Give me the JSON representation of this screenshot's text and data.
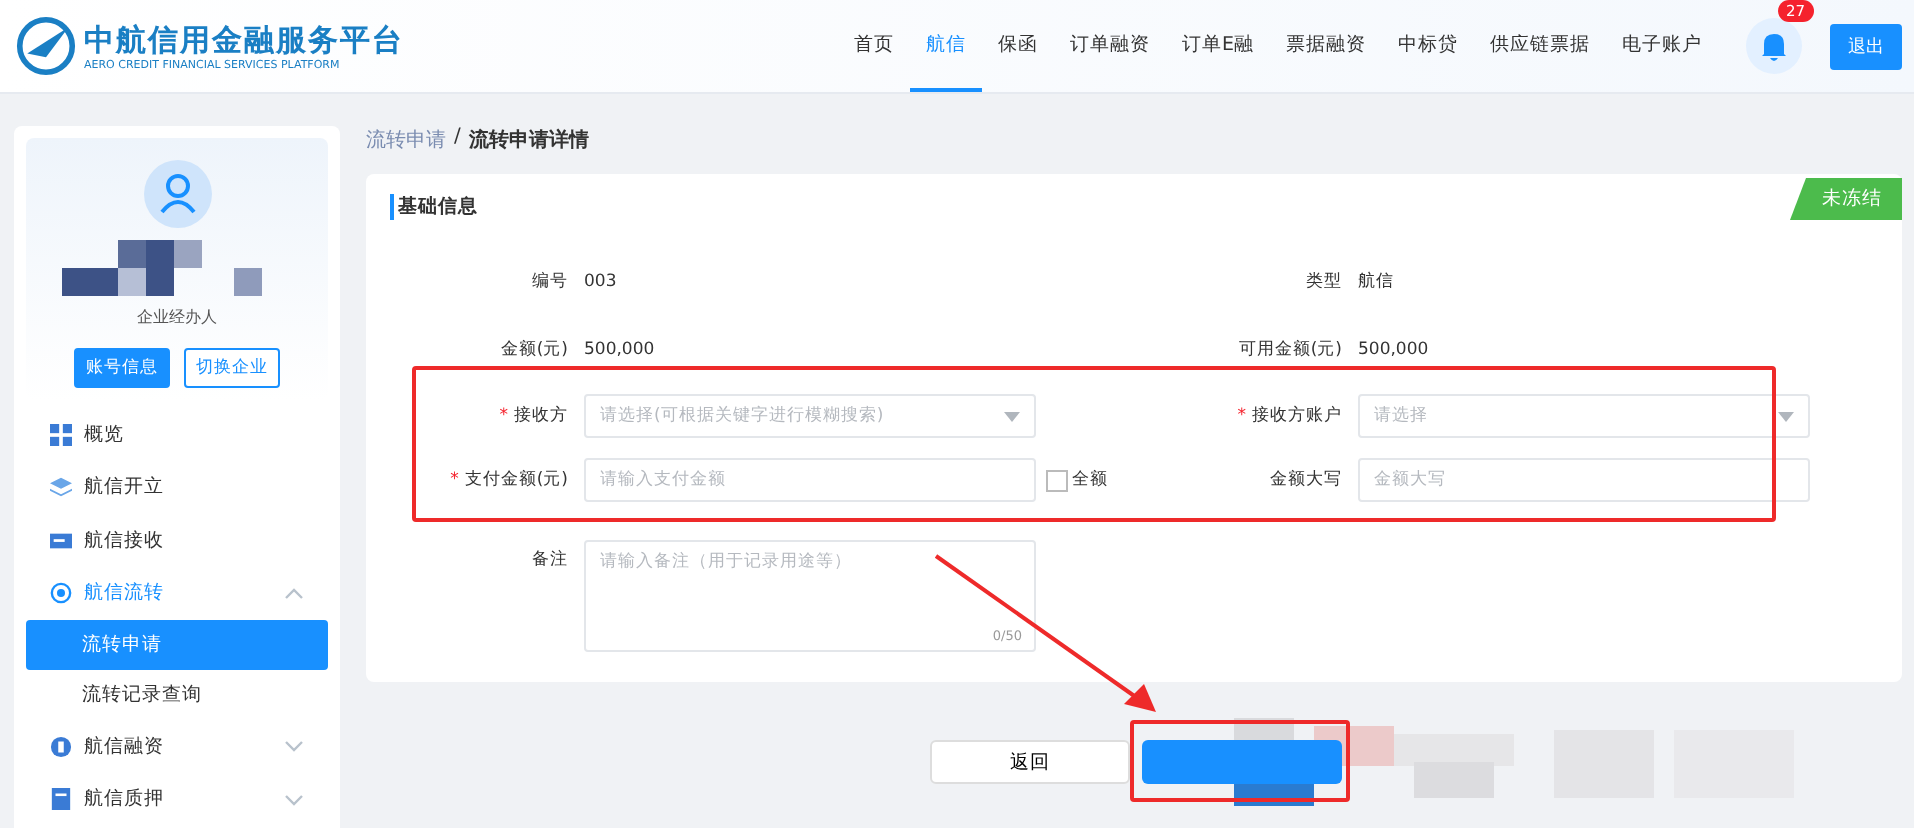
{
  "header": {
    "logo_title": "中航信用金融服务平台",
    "logo_subtitle": "AERO CREDIT FINANCIAL SERVICES PLATFORM",
    "nav": [
      {
        "label": "首页",
        "selected": false
      },
      {
        "label": "航信",
        "selected": true
      },
      {
        "label": "保函",
        "selected": false
      },
      {
        "label": "订单融资",
        "selected": false
      },
      {
        "label": "订单E融",
        "selected": false
      },
      {
        "label": "票据融资",
        "selected": false
      },
      {
        "label": "中标贷",
        "selected": false
      },
      {
        "label": "供应链票据",
        "selected": false
      },
      {
        "label": "电子账户",
        "selected": false
      }
    ],
    "notification_count": "27",
    "logout": "退出"
  },
  "sidebar": {
    "role": "企业经办人",
    "buttons": [
      {
        "label": "账号信息",
        "kind": "primary"
      },
      {
        "label": "切换企业",
        "kind": "outline"
      }
    ],
    "items": [
      {
        "label": "概览"
      },
      {
        "label": "航信开立"
      },
      {
        "label": "航信接收"
      },
      {
        "label": "航信流转",
        "expanded": true,
        "children": [
          {
            "label": "流转申请",
            "selected": true
          },
          {
            "label": "流转记录查询",
            "selected": false
          }
        ]
      },
      {
        "label": "航信融资",
        "expanded": false
      },
      {
        "label": "航信质押",
        "expanded": false
      }
    ]
  },
  "breadcrumb": {
    "separator": "/",
    "items": [
      {
        "label": "流转申请"
      },
      {
        "label": "流转申请详情"
      }
    ]
  },
  "required_mark": "*",
  "section_title": "基础信息",
  "status_ribbon": "未冻结",
  "info": [
    {
      "left_label": "编号",
      "left_value": "003",
      "right_label": "类型",
      "right_value": "航信"
    },
    {
      "left_label": "金额(元)",
      "left_value": "500,000",
      "right_label": "可用金额(元)",
      "right_value": "500,000"
    }
  ],
  "form": [
    {
      "left": {
        "label": "接收方",
        "required": true,
        "kind": "select",
        "placeholder": "请选择(可根据关键字进行模糊搜索)"
      },
      "right": {
        "label": "接收方账户",
        "required": true,
        "kind": "select",
        "placeholder": "请选择"
      }
    },
    {
      "left": {
        "label": "支付金额(元)",
        "required": true,
        "kind": "input",
        "placeholder": "请输入支付金额",
        "checkbox": {
          "label": "全额",
          "checked": false
        }
      },
      "right": {
        "label": "金额大写",
        "required": false,
        "kind": "input",
        "placeholder": "金额大写"
      }
    }
  ],
  "remark": {
    "label": "备注",
    "placeholder": "请输入备注（用于记录用途等）",
    "counter": "0/50"
  },
  "actions": {
    "back": "返回"
  }
}
